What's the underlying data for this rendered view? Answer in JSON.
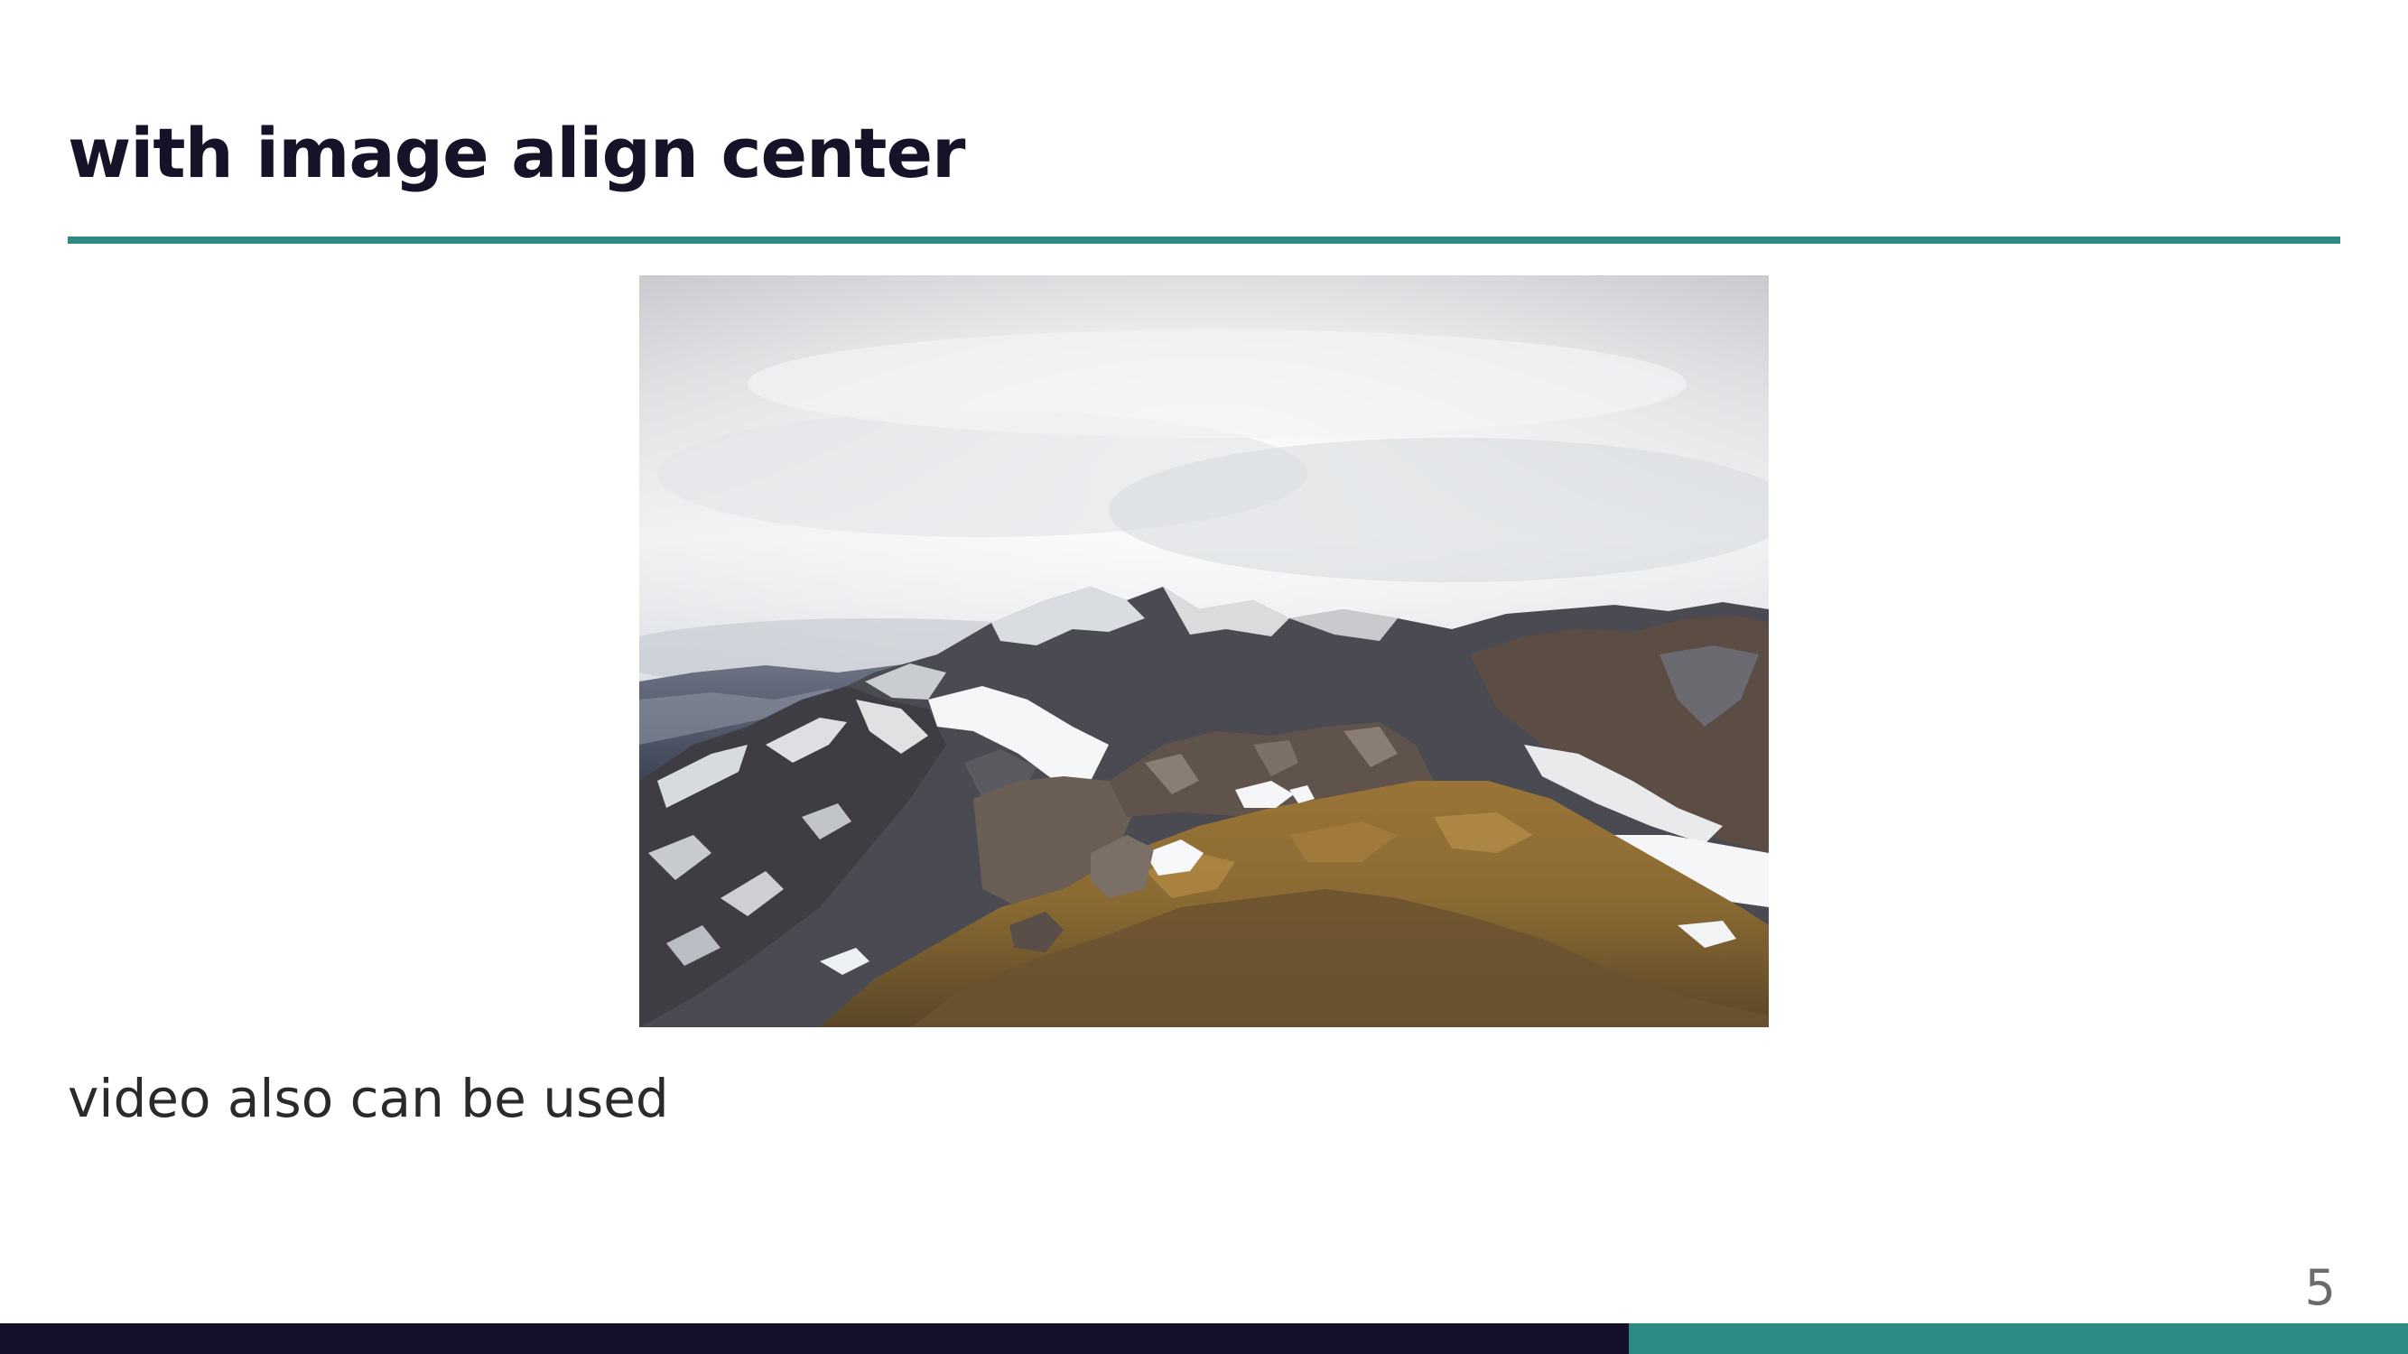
{
  "slide": {
    "title": "with image align center",
    "body_text": "video also can be used",
    "page_number": "5",
    "image": {
      "subject": "mountain-landscape-photo"
    }
  },
  "colors": {
    "title_text": "#161329",
    "title_rule": "#2e8b83",
    "footer_dark": "#15112b",
    "footer_accent": "#2e8b83",
    "page_number": "#6b6b6b"
  }
}
